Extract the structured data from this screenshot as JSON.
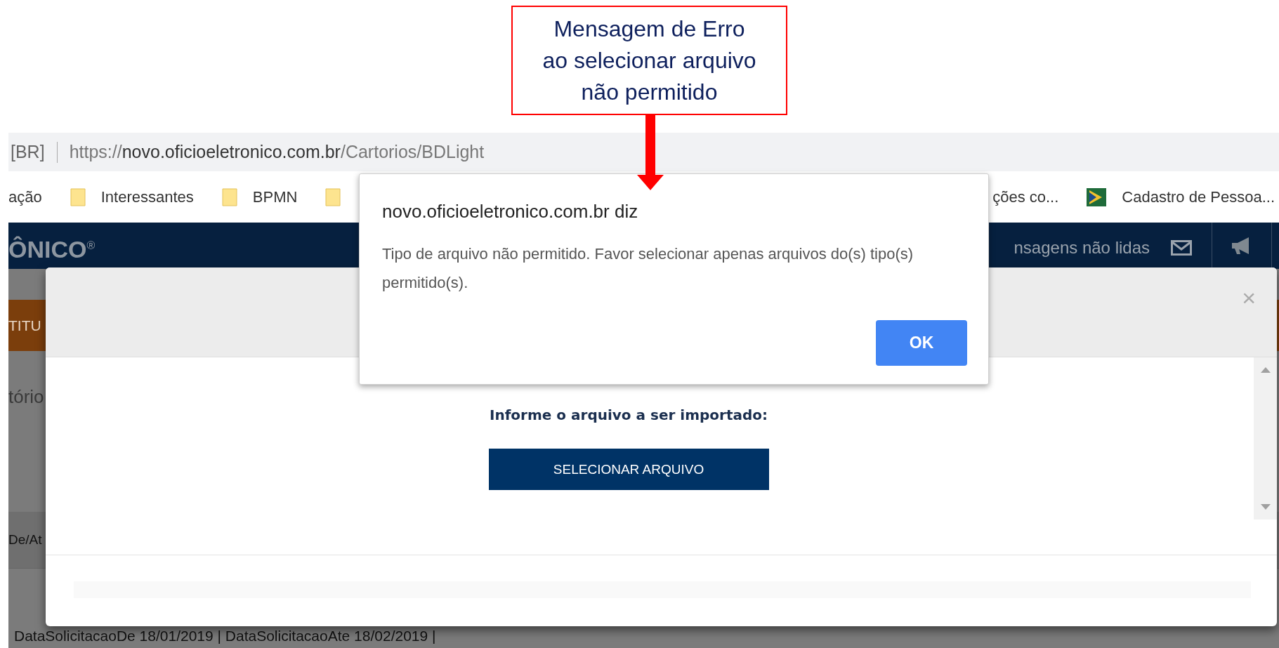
{
  "annotation": {
    "lines": [
      "Mensagem de Erro",
      "ao selecionar arquivo",
      "não permitido"
    ]
  },
  "address_bar": {
    "prefix": "[BR]",
    "scheme": "https://",
    "host": "novo.oficioeletronico.com.br",
    "path": "/Cartorios/BDLight"
  },
  "bookmarks": [
    {
      "kind": "text",
      "label": "ação"
    },
    {
      "kind": "folder",
      "label": "Interessantes"
    },
    {
      "kind": "folder",
      "label": "BPMN"
    },
    {
      "kind": "folder"
    },
    {
      "kind": "gap"
    },
    {
      "kind": "text",
      "label": "ções co..."
    },
    {
      "kind": "site",
      "label": "Cadastro de Pessoa..."
    }
  ],
  "header": {
    "logo": "ÔNICO",
    "logo_mark": "®",
    "messages": "nsagens não lidas"
  },
  "background_page": {
    "tab": "TITU",
    "section": "tório",
    "column": "De/At",
    "filter_line": "DataSolicitacaoDe 18/01/2019 | DataSolicitacaoAte 18/02/2019 |"
  },
  "modal": {
    "close": "×",
    "prompt": "Informe o arquivo a ser importado:",
    "button": "SELECIONAR ARQUIVO"
  },
  "alert": {
    "title": "novo.oficioeletronico.com.br diz",
    "message": "Tipo de arquivo não permitido. Favor selecionar apenas arquivos do(s) tipo(s) permitido(s).",
    "button": "OK"
  }
}
